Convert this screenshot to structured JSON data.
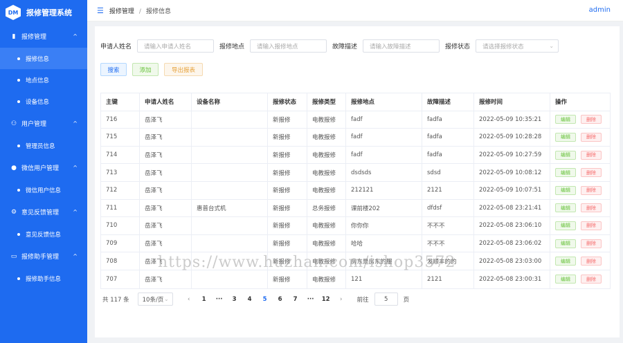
{
  "app": {
    "logo_text": "DM",
    "title": "报修管理系统"
  },
  "sidebar": {
    "groups": [
      {
        "label": "报修管理",
        "icon": "chart-icon",
        "chevron": "^",
        "items": [
          {
            "label": "报修信息",
            "active": true
          },
          {
            "label": "地点信息"
          },
          {
            "label": "设备信息"
          }
        ]
      },
      {
        "label": "用户管理",
        "icon": "user-icon",
        "chevron": "^",
        "items": [
          {
            "label": "管理员信息"
          }
        ]
      },
      {
        "label": "微信用户管理",
        "icon": "person-icon",
        "chevron": "^",
        "items": [
          {
            "label": "微信用户信息"
          }
        ]
      },
      {
        "label": "意见反馈管理",
        "icon": "gear-icon",
        "chevron": "^",
        "items": [
          {
            "label": "意见反馈信息"
          }
        ]
      },
      {
        "label": "报修助手管理",
        "icon": "box-icon",
        "chevron": "^",
        "items": [
          {
            "label": "报修助手信息"
          }
        ]
      }
    ]
  },
  "header": {
    "breadcrumb": [
      "报修管理",
      "报修信息"
    ],
    "separator": "/",
    "user": "admin"
  },
  "filters": [
    {
      "label": "申请人姓名",
      "placeholder": "请输入申请人姓名"
    },
    {
      "label": "报修地点",
      "placeholder": "请输入报修地点"
    },
    {
      "label": "故障描述",
      "placeholder": "请输入故障描述"
    },
    {
      "label": "报修状态",
      "placeholder": "请选择报修状态",
      "select": true
    }
  ],
  "buttons": {
    "search": "搜索",
    "add": "添加",
    "export": "导出报表"
  },
  "table": {
    "headers": [
      "主键",
      "申请人姓名",
      "设备名称",
      "报修状态",
      "报修类型",
      "报修地点",
      "故障描述",
      "报修时间",
      "操作"
    ],
    "edit_label": "编辑",
    "delete_label": "删除",
    "rows": [
      [
        "716",
        "岳泽飞",
        "",
        "新报修",
        "电教报修",
        "fadf",
        "fadfa",
        "2022-05-09 10:35:21"
      ],
      [
        "715",
        "岳泽飞",
        "",
        "新报修",
        "电教报修",
        "fadf",
        "fadfa",
        "2022-05-09 10:28:28"
      ],
      [
        "714",
        "岳泽飞",
        "",
        "新报修",
        "电教报修",
        "fadf",
        "fadfa",
        "2022-05-09 10:27:59"
      ],
      [
        "713",
        "岳泽飞",
        "",
        "新报修",
        "电教报修",
        "dsdsds",
        "sdsd",
        "2022-05-09 10:08:12"
      ],
      [
        "712",
        "岳泽飞",
        "",
        "新报修",
        "电教报修",
        "212121",
        "2121",
        "2022-05-09 10:07:51"
      ],
      [
        "711",
        "岳泽飞",
        "惠普台式机",
        "新报修",
        "总务报修",
        "课前楼202",
        "dfdsf",
        "2022-05-08 23:21:41"
      ],
      [
        "710",
        "岳泽飞",
        "",
        "新报修",
        "电教报修",
        "你你你",
        "不不不",
        "2022-05-08 23:06:10"
      ],
      [
        "709",
        "岳泽飞",
        "",
        "新报修",
        "电教报修",
        "哈哈",
        "不不不",
        "2022-05-08 23:06:02"
      ],
      [
        "708",
        "岳泽飞",
        "",
        "新报修",
        "电教报修",
        "房东是房东的服",
        "发顺丰的的",
        "2022-05-08 23:03:00"
      ],
      [
        "707",
        "岳泽飞",
        "",
        "新报修",
        "电教报修",
        "121",
        "2121",
        "2022-05-08 23:00:31"
      ]
    ]
  },
  "pagination": {
    "total": "共 117 条",
    "page_size": "10条/页",
    "prev": "‹",
    "next": "›",
    "pages": [
      "1",
      "···",
      "3",
      "4",
      "5",
      "6",
      "7",
      "···",
      "12"
    ],
    "current": "5",
    "goto_label": "前往",
    "goto_value": "5",
    "page_unit": "页"
  },
  "watermark": "https://www.huzhan.com/ishop3572",
  "colors": {
    "primary": "#1e6bf0",
    "success": "#67c23a",
    "warning": "#e6a23c",
    "danger": "#f56c6c"
  }
}
